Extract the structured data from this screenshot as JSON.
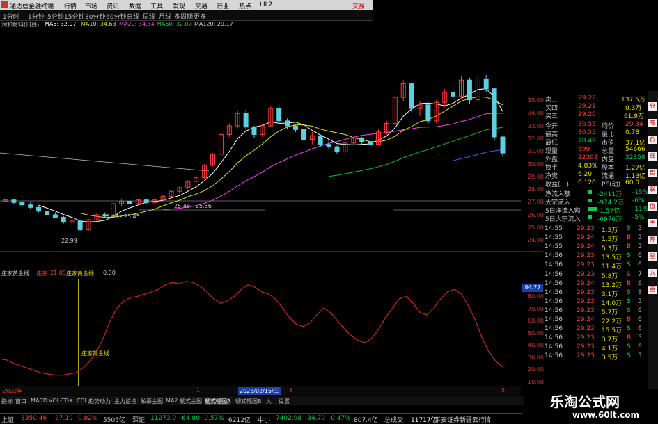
{
  "window": {
    "title": "通达信金融终端",
    "right_label": "交易"
  },
  "menu": [
    "行情",
    "市场",
    "资讯",
    "数据",
    "工具",
    "发现",
    "交易",
    "行业",
    "热点",
    "LIL2"
  ],
  "periods": [
    "1分时",
    "1分钟",
    "5分钟",
    "15分钟",
    "30分钟",
    "60分钟",
    "日线",
    "周线",
    "月线",
    "多周期",
    "更多"
  ],
  "ma_line": {
    "stock": "润和材料(日线)",
    "ma5": "MA5: 32.07",
    "ma10": "MA10: 34.63",
    "ma20": "MA20: 34.34",
    "ma60": "MA60: 32.07",
    "ma120": "MA120: 29.17"
  },
  "price_scale": [
    "35.00",
    "34.00",
    "33.00",
    "32.00",
    "31.00",
    "30.00",
    "29.00",
    "28.00",
    "27.00",
    "26.00",
    "25.00",
    "24.00"
  ],
  "annotations": {
    "low": "22.99",
    "range1": "25.43 - 25.45",
    "range2": "25.48 - 25.56"
  },
  "indicator": {
    "name": "庄家黄金线",
    "sub": "庄家",
    "val1": "21.05",
    "name2": "庄家黄金线",
    "val2": "0.00",
    "marker": "庄家黄金线",
    "current": "84.77"
  },
  "ind_scale": [
    "80.00",
    "70.00",
    "60.00",
    "50.00",
    "40.00",
    "30.00",
    "20.00",
    "10.00"
  ],
  "dates": {
    "year": "2022年",
    "sel": "2023/02/15/三",
    "m1": "1",
    "m3": "3",
    "m5": "5"
  },
  "tabs": [
    "指标",
    "窗口",
    "MACD",
    "VOL-TDX",
    "CCI",
    "趋势动力",
    "主力监控",
    "私募主图",
    "MA2",
    "韧式主图",
    "韧式幅图A",
    "韧式幅图B",
    "大",
    "设置"
  ],
  "quote": {
    "sell3": {
      "label": "卖三",
      "price": "29.22",
      "vol": "137.5万"
    },
    "sell4": {
      "label": "买四",
      "price": "29.21",
      "vol": "0.3万"
    },
    "sell5": {
      "label": "买五",
      "price": "29.20",
      "vol": "61.9万"
    },
    "rows": [
      {
        "l": "今开",
        "v": "30.55",
        "l2": "均价",
        "v2": "29.34"
      },
      {
        "l": "最高",
        "v": "30.55",
        "l2": "量比",
        "v2": "0.78"
      },
      {
        "l": "最低",
        "v": "28.49",
        "l2": "市值",
        "v2": "37.1亿"
      },
      {
        "l": "现量",
        "v": "699",
        "l2": "总量",
        "v2": "54666"
      },
      {
        "l": "外盘",
        "v": "22308",
        "l2": "内盘",
        "v2": "32358"
      },
      {
        "l": "换手",
        "v": "4.83%",
        "l2": "股本",
        "v2": "1.27亿"
      },
      {
        "l": "净资",
        "v": "6.20",
        "l2": "流通",
        "v2": "1.13亿"
      },
      {
        "l": "收益(一)",
        "v": "0.120",
        "l2": "PE(动)",
        "v2": "60.0"
      }
    ],
    "flows": [
      {
        "l": "净流入额",
        "v": "-2411万",
        "p": "-15%"
      },
      {
        "l": "大宗流入",
        "v": "-974.2万",
        "p": "-6%"
      },
      {
        "l": "5日净流入额",
        "v": "-1.57亿",
        "p": "-11%"
      },
      {
        "l": "5日大宗流入",
        "v": "-6976万",
        "p": "-5%"
      }
    ]
  },
  "ticks": [
    {
      "t": "14:55",
      "p": "29.23",
      "v": "1.5万",
      "s": "S",
      "c": "5"
    },
    {
      "t": "14:55",
      "p": "29.24",
      "v": "1.5万",
      "s": "B",
      "c": "5"
    },
    {
      "t": "14:55",
      "p": "29.24",
      "v": "5.3万",
      "s": "B",
      "c": "5"
    },
    {
      "t": "14:56",
      "p": "29.23",
      "v": "13.5万",
      "s": "S",
      "c": "6"
    },
    {
      "t": "14:56",
      "p": "29.23",
      "v": "11.4万",
      "s": "S",
      "c": "6"
    },
    {
      "t": "14:56",
      "p": "29.23",
      "v": "5.8万",
      "s": "S",
      "c": "7"
    },
    {
      "t": "14:56",
      "p": "29.24",
      "v": "13.2万",
      "s": "B",
      "c": "6"
    },
    {
      "t": "14:56",
      "p": "29.23",
      "v": "3.1万",
      "s": "S",
      "c": "8"
    },
    {
      "t": "14:56",
      "p": "29.23",
      "v": "14.0万",
      "s": "S",
      "c": "5"
    },
    {
      "t": "14:56",
      "p": "29.23",
      "v": "5.7万",
      "s": "S",
      "c": "6"
    },
    {
      "t": "14:56",
      "p": "29.24",
      "v": "22.2万",
      "s": "B",
      "c": "6"
    },
    {
      "t": "14:56",
      "p": "29.22",
      "v": "15.5万",
      "s": "S",
      "c": "6"
    },
    {
      "t": "14:56",
      "p": "29.23",
      "v": "3.7万",
      "s": "B",
      "c": "5"
    },
    {
      "t": "14:56",
      "p": "29.23",
      "v": "4.1万",
      "s": "S",
      "c": "6"
    },
    {
      "t": "14:56",
      "p": "29.23",
      "v": "3.5万",
      "s": "S",
      "c": "5"
    }
  ],
  "status": {
    "sh": "上证",
    "sh_v": "3350.46",
    "sh_c": "27.19",
    "sh_p": "0.82%",
    "sh_a": "5505亿",
    "sz": "深证",
    "sz_v": "11273.9",
    "sz_c": "-64.80",
    "sz_p": "-0.57%",
    "sz_a": "6212亿",
    "zx": "中小",
    "zx_v": "7402.98",
    "zx_c": "-34.79",
    "zx_p": "-0.47%",
    "zx_a": "807.4亿",
    "total": "总成交",
    "total_v": "11717亿",
    "feed": "平安证券新疆云行情"
  },
  "side_icons": [
    "分",
    "笔",
    "价",
    "细",
    "势",
    "联",
    "值",
    "主",
    "筹",
    "星",
    "入",
    "更"
  ],
  "watermark": {
    "l1": "乐淘公式网",
    "l2": "www.60lt.com"
  },
  "chart_data": {
    "type": "line",
    "title": "",
    "kline_ylim": [
      22.5,
      36.0
    ],
    "candles": [
      [
        25.4,
        25.6,
        25.3,
        25.5
      ],
      [
        25.5,
        25.5,
        25.2,
        25.3
      ],
      [
        25.3,
        25.4,
        25.0,
        25.1
      ],
      [
        25.1,
        25.3,
        24.8,
        24.9
      ],
      [
        24.9,
        25.0,
        24.5,
        24.6
      ],
      [
        24.6,
        24.7,
        24.2,
        24.3
      ],
      [
        24.3,
        24.5,
        24.0,
        24.1
      ],
      [
        24.1,
        24.2,
        23.6,
        23.7
      ],
      [
        23.7,
        23.9,
        23.5,
        23.8
      ],
      [
        23.8,
        23.9,
        23.0,
        23.1
      ],
      [
        23.1,
        24.0,
        22.99,
        23.9
      ],
      [
        23.9,
        24.4,
        23.8,
        24.3
      ],
      [
        24.3,
        24.5,
        24.1,
        24.2
      ],
      [
        24.2,
        25.3,
        24.1,
        25.2
      ],
      [
        25.2,
        25.6,
        25.0,
        25.4
      ],
      [
        25.4,
        25.5,
        25.1,
        25.2
      ],
      [
        25.2,
        25.6,
        25.1,
        25.5
      ],
      [
        25.5,
        25.6,
        25.2,
        25.3
      ],
      [
        25.3,
        25.6,
        25.2,
        25.5
      ],
      [
        25.5,
        25.9,
        25.4,
        25.8
      ],
      [
        25.8,
        26.3,
        25.7,
        26.2
      ],
      [
        26.2,
        26.6,
        26.0,
        26.5
      ],
      [
        26.5,
        27.1,
        26.4,
        27.0
      ],
      [
        27.0,
        27.5,
        26.8,
        27.3
      ],
      [
        27.3,
        28.4,
        27.2,
        28.3
      ],
      [
        28.3,
        29.3,
        28.2,
        29.2
      ],
      [
        29.2,
        31.0,
        29.1,
        30.8
      ],
      [
        30.8,
        31.7,
        30.6,
        31.5
      ],
      [
        31.5,
        32.7,
        31.3,
        32.5
      ],
      [
        32.5,
        32.8,
        31.2,
        31.4
      ],
      [
        31.4,
        31.5,
        30.5,
        30.8
      ],
      [
        30.8,
        31.6,
        30.6,
        31.5
      ],
      [
        31.5,
        33.1,
        31.4,
        32.9
      ],
      [
        32.9,
        33.2,
        31.6,
        31.9
      ],
      [
        31.9,
        32.1,
        31.2,
        31.5
      ],
      [
        31.5,
        31.6,
        31.0,
        31.2
      ],
      [
        31.2,
        31.3,
        30.2,
        30.4
      ],
      [
        30.4,
        31.0,
        30.0,
        30.7
      ],
      [
        30.7,
        30.8,
        29.8,
        30.0
      ],
      [
        30.0,
        30.4,
        29.6,
        29.8
      ],
      [
        29.8,
        29.9,
        29.2,
        29.4
      ],
      [
        29.4,
        30.2,
        29.3,
        30.1
      ],
      [
        30.1,
        30.6,
        29.9,
        30.5
      ],
      [
        30.5,
        30.6,
        30.0,
        30.2
      ],
      [
        30.2,
        30.4,
        29.8,
        30.0
      ],
      [
        30.0,
        31.2,
        29.9,
        31.0
      ],
      [
        31.0,
        31.9,
        30.8,
        31.7
      ],
      [
        31.7,
        34.0,
        31.6,
        33.8
      ],
      [
        33.8,
        35.2,
        33.5,
        34.9
      ],
      [
        34.9,
        35.0,
        32.6,
        32.9
      ],
      [
        32.9,
        33.5,
        32.3,
        33.2
      ],
      [
        33.2,
        33.4,
        31.6,
        31.9
      ],
      [
        31.9,
        33.6,
        31.7,
        33.4
      ],
      [
        33.4,
        34.5,
        33.0,
        34.2
      ],
      [
        34.2,
        34.8,
        33.6,
        33.9
      ],
      [
        33.9,
        35.5,
        33.7,
        35.2
      ],
      [
        35.2,
        35.4,
        33.3,
        33.6
      ],
      [
        33.6,
        35.6,
        33.4,
        35.3
      ],
      [
        35.3,
        35.6,
        34.2,
        34.5
      ],
      [
        34.5,
        34.6,
        30.3,
        30.6
      ],
      [
        30.6,
        30.7,
        29.0,
        29.3
      ]
    ],
    "indicator_ylim": [
      0,
      90
    ],
    "indicator": [
      22,
      21,
      18,
      16,
      14,
      12,
      10,
      9,
      8,
      8,
      9,
      10,
      14,
      20,
      28,
      40,
      55,
      66,
      72,
      75,
      76,
      78,
      80,
      82,
      86,
      88,
      87,
      89,
      88,
      85,
      80,
      74,
      70,
      72,
      76,
      82,
      86,
      84,
      80,
      78,
      74,
      66,
      58,
      52,
      50,
      53,
      60,
      66,
      62,
      55,
      48,
      42,
      38,
      36,
      40,
      48,
      58,
      66,
      74,
      76,
      70,
      62,
      60,
      66,
      74,
      80,
      82,
      78,
      68,
      56,
      40,
      28,
      20,
      15
    ]
  }
}
